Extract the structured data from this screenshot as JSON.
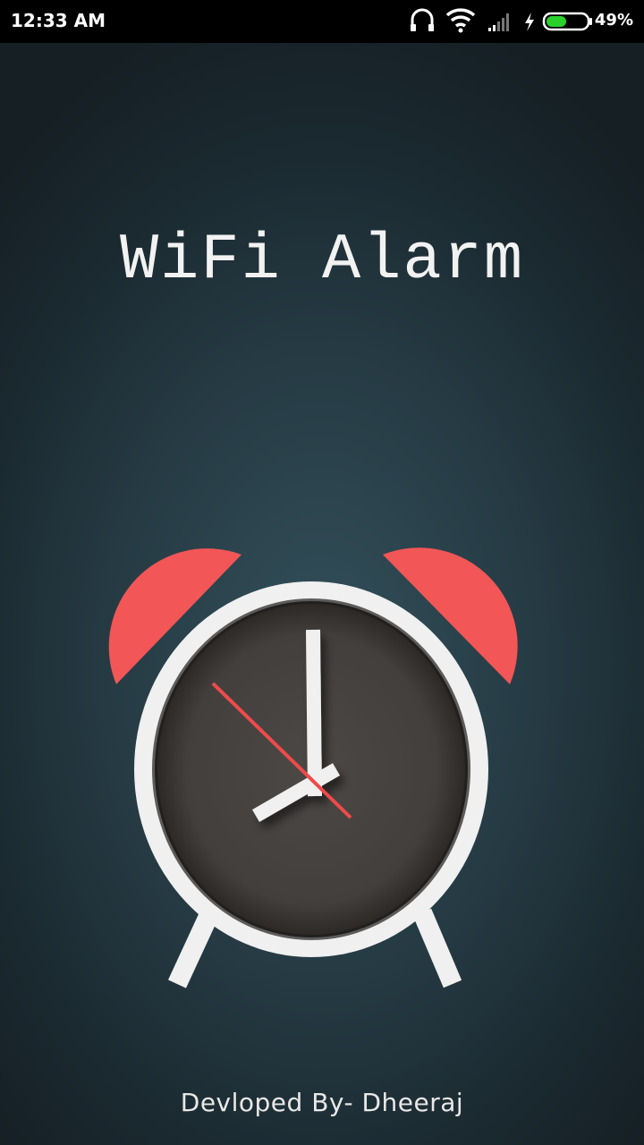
{
  "status_bar": {
    "time": "12:33 AM",
    "battery_percent": "49%",
    "battery_level": 0.49,
    "icons": [
      "headset-icon",
      "wifi-icon",
      "signal-icon",
      "charging-bolt-icon",
      "battery-icon"
    ]
  },
  "splash": {
    "title": "WiFi Alarm",
    "credit": "Devloped By- Dheeraj"
  },
  "colors": {
    "bell_red": "#f25656",
    "clock_frame": "#f0f0f0",
    "clock_face": "#454240",
    "second_hand": "#ee4b4b",
    "battery_fill": "#2bd02b"
  }
}
